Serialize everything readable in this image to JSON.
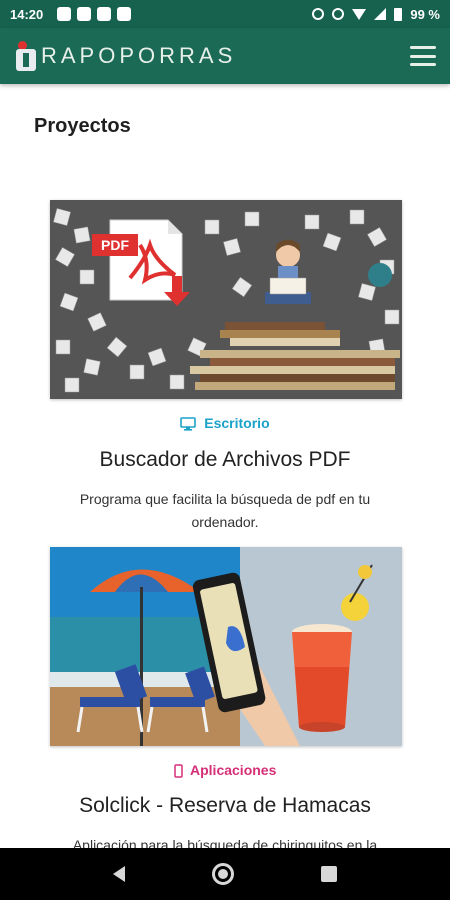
{
  "status_bar": {
    "time": "14:20",
    "battery": "99 %",
    "left_icons": [
      "whatsapp-icon",
      "photo-icon",
      "parking-icon",
      "photo-icon"
    ],
    "right_icons": [
      "alarm-icon",
      "vibrate-icon",
      "wifi-icon",
      "signal-icon",
      "battery-icon"
    ]
  },
  "app_bar": {
    "logo_text": "RAPOPORRAS",
    "menu_icon": "hamburger-menu-icon"
  },
  "content": {
    "section_title": "Proyectos",
    "projects": [
      {
        "category": "Escritorio",
        "category_icon": "monitor-icon",
        "category_color": "#1aa2c9",
        "title": "Buscador de Archivos PDF",
        "description": "Programa que facilita la búsqueda de pdf en tu ordenador.",
        "image_overlay": "PDF"
      },
      {
        "category": "Aplicaciones",
        "category_icon": "mobile-icon",
        "category_color": "#d62f78",
        "title": "Solclick - Reserva de Hamacas",
        "description": "Aplicación para la búsqueda de chiringuitos en la"
      }
    ]
  },
  "nav_bar": {
    "icons": [
      "back-icon",
      "home-icon",
      "recents-icon"
    ]
  },
  "colors": {
    "primary": "#1a6a56",
    "status_bar": "#17614f"
  }
}
